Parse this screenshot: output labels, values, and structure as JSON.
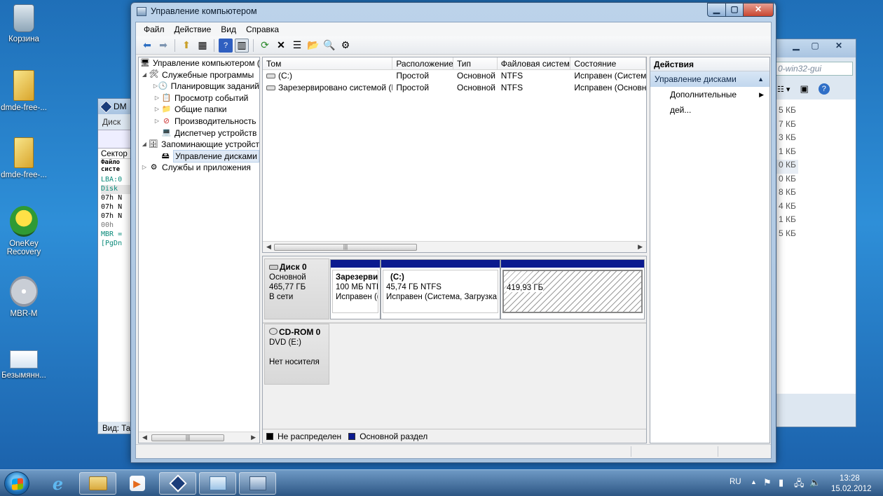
{
  "desktop": {
    "icons": [
      {
        "label": "Корзина"
      },
      {
        "label": "dmde-free-..."
      },
      {
        "label": "dmde-free-..."
      },
      {
        "label": "OneKey Recovery"
      },
      {
        "label": "MBR-M"
      },
      {
        "label": "Безымянн..."
      }
    ]
  },
  "bg_dmde": {
    "title": "DM",
    "tab": "Диск",
    "sector_label": "Сектор",
    "col_label": "Файло систе",
    "lines": [
      "LBA:0",
      "Disk",
      "07h N",
      "07h N",
      "07h N",
      "00h",
      "MBR =",
      "[PgDn"
    ],
    "view_label": "Вид: Та"
  },
  "bg_explorer": {
    "search_placeholder": "0-win32-gui",
    "sizes": [
      "5 КБ",
      "7 КБ",
      "3 КБ",
      "1 КБ",
      "0 КБ",
      "0 КБ",
      "8 КБ",
      "4 КБ",
      "1 КБ",
      "5 КБ"
    ]
  },
  "window": {
    "title": "Управление компьютером",
    "menu": [
      "Файл",
      "Действие",
      "Вид",
      "Справка"
    ]
  },
  "tree": {
    "items": [
      {
        "label": "Управление компьютером (л",
        "level": 0,
        "arrow": "",
        "icon": "computer-icon"
      },
      {
        "label": "Служебные программы",
        "level": 1,
        "arrow": "◢",
        "icon": "tools-icon"
      },
      {
        "label": "Планировщик заданий",
        "level": 2,
        "arrow": "▷",
        "icon": "clock-icon"
      },
      {
        "label": "Просмотр событий",
        "level": 2,
        "arrow": "▷",
        "icon": "event-viewer-icon"
      },
      {
        "label": "Общие папки",
        "level": 2,
        "arrow": "▷",
        "icon": "shared-folder-icon"
      },
      {
        "label": "Производительность",
        "level": 2,
        "arrow": "▷",
        "icon": "performance-icon"
      },
      {
        "label": "Диспетчер устройств",
        "level": 2,
        "arrow": "",
        "icon": "device-manager-icon"
      },
      {
        "label": "Запоминающие устройст",
        "level": 1,
        "arrow": "◢",
        "icon": "storage-icon"
      },
      {
        "label": "Управление дисками",
        "level": 2,
        "arrow": "",
        "icon": "disk-management-icon",
        "selected": true
      },
      {
        "label": "Службы и приложения",
        "level": 1,
        "arrow": "▷",
        "icon": "services-icon"
      }
    ]
  },
  "volumes": {
    "columns": [
      "Том",
      "Расположение",
      "Тип",
      "Файловая система",
      "Состояние"
    ],
    "rows": [
      [
        "(C:)",
        "Простой",
        "Основной",
        "NTFS",
        "Исправен (Система,"
      ],
      [
        "Зарезервировано системой (M:)",
        "Простой",
        "Основной",
        "NTFS",
        "Исправен (Основно"
      ]
    ]
  },
  "disks": {
    "disk0": {
      "name": "Диск 0",
      "type": "Основной",
      "size": "465,77 ГБ",
      "status": "В сети",
      "partitions": [
        {
          "name": "Зарезерви",
          "size": "100 МБ NTF",
          "status": "Исправен (("
        },
        {
          "name": "(C:)",
          "size": "45,74 ГБ NTFS",
          "status": "Исправен (Система, Загрузка, "
        },
        {
          "name": "",
          "size": "419,93 ГБ",
          "status": ""
        }
      ]
    },
    "cdrom0": {
      "name": "CD-ROM 0",
      "type": "DVD (E:)",
      "status": "Нет носителя"
    },
    "legend": {
      "unallocated": "Не распределен",
      "primary": "Основной раздел"
    }
  },
  "actions": {
    "title": "Действия",
    "section": "Управление дисками",
    "more": "Дополнительные дей..."
  },
  "taskbar": {
    "lang": "RU",
    "time": "13:28",
    "date": "15.02.2012"
  },
  "colors": {
    "partition_bar": "#0b1a8f",
    "unallocated": "#000000",
    "selection": "#dfe9f5"
  }
}
